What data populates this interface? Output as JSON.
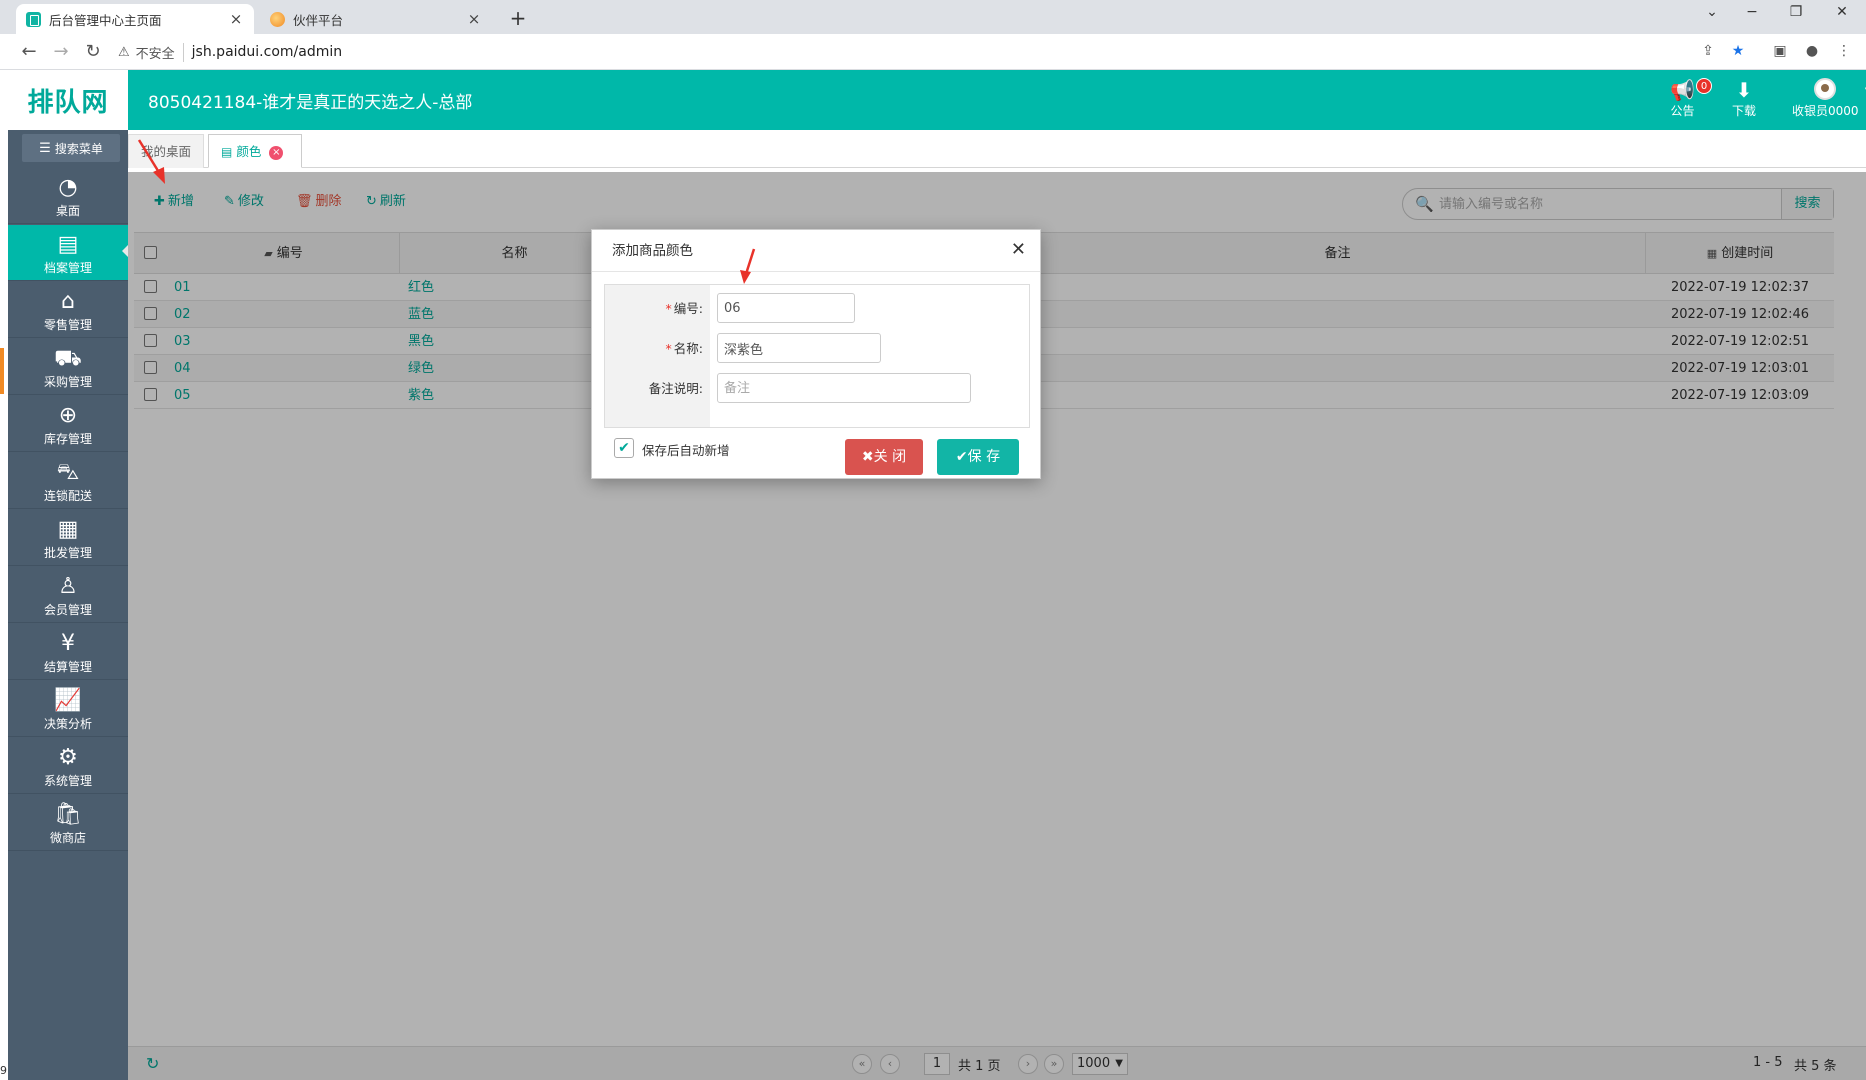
{
  "browser": {
    "tabs": [
      {
        "title": "后台管理中心主页面",
        "close": "×"
      },
      {
        "title": "伙伴平台",
        "close": "×"
      }
    ],
    "new_tab": "+",
    "window_controls": {
      "collapse": "⌄",
      "minimize": "−",
      "restore": "❐",
      "close": "✕"
    },
    "insecure_label": "不安全",
    "url": "jsh.paidui.com/admin"
  },
  "header": {
    "logo": "排队网",
    "store_title": "8050421184-谁才是真正的天选之人-总部",
    "notice_label": "公告",
    "notice_badge": "0",
    "download_label": "下载",
    "user_label": "收银员0000"
  },
  "sidebar": {
    "search_label": "搜索菜单",
    "items": [
      {
        "label": "桌面",
        "icon": "dashboard-icon"
      },
      {
        "label": "档案管理",
        "icon": "archive-icon",
        "active": true
      },
      {
        "label": "零售管理",
        "icon": "store-icon"
      },
      {
        "label": "采购管理",
        "icon": "cart-icon"
      },
      {
        "label": "库存管理",
        "icon": "inventory-icon"
      },
      {
        "label": "连锁配送",
        "icon": "truck-icon"
      },
      {
        "label": "批发管理",
        "icon": "wholesale-icon"
      },
      {
        "label": "会员管理",
        "icon": "member-icon"
      },
      {
        "label": "结算管理",
        "icon": "settlement-icon"
      },
      {
        "label": "决策分析",
        "icon": "analysis-icon"
      },
      {
        "label": "系统管理",
        "icon": "gear-icon"
      },
      {
        "label": "微商店",
        "icon": "shop-icon"
      }
    ]
  },
  "page_tabs": [
    {
      "label": "我的桌面"
    },
    {
      "label": "颜色"
    }
  ],
  "toolbar": {
    "add": "新增",
    "edit": "修改",
    "delete": "删除",
    "refresh": "刷新",
    "search_placeholder": "请输入编号或名称",
    "search_button": "搜索"
  },
  "grid": {
    "columns": [
      "编号",
      "名称",
      "备注",
      "创建时间"
    ],
    "rows": [
      {
        "code": "01",
        "name": "红色",
        "remark": "",
        "created": "2022-07-19 12:02:37"
      },
      {
        "code": "02",
        "name": "蓝色",
        "remark": "",
        "created": "2022-07-19 12:02:46"
      },
      {
        "code": "03",
        "name": "黑色",
        "remark": "",
        "created": "2022-07-19 12:02:51"
      },
      {
        "code": "04",
        "name": "绿色",
        "remark": "",
        "created": "2022-07-19 12:03:01"
      },
      {
        "code": "05",
        "name": "紫色",
        "remark": "",
        "created": "2022-07-19 12:03:09"
      }
    ]
  },
  "pager": {
    "current_page": "1",
    "total_pages": "共 1 页",
    "page_size": "1000",
    "range": "1 - 5",
    "total": "共 5 条"
  },
  "dialog": {
    "title": "添加商品颜色",
    "code_label": "编号:",
    "code_value": "06",
    "name_label": "名称:",
    "name_value": "深紫色",
    "remark_label": "备注说明:",
    "remark_placeholder": "备注",
    "auto_new_label": "保存后自动新增",
    "close_button": "关 闭",
    "save_button": "保 存"
  },
  "edge_text": "9",
  "colors": {
    "brand": "#00b8a9",
    "sidebar": "#4b5d6e",
    "danger": "#d9534f",
    "annotation_arrow": "#e8322a"
  }
}
